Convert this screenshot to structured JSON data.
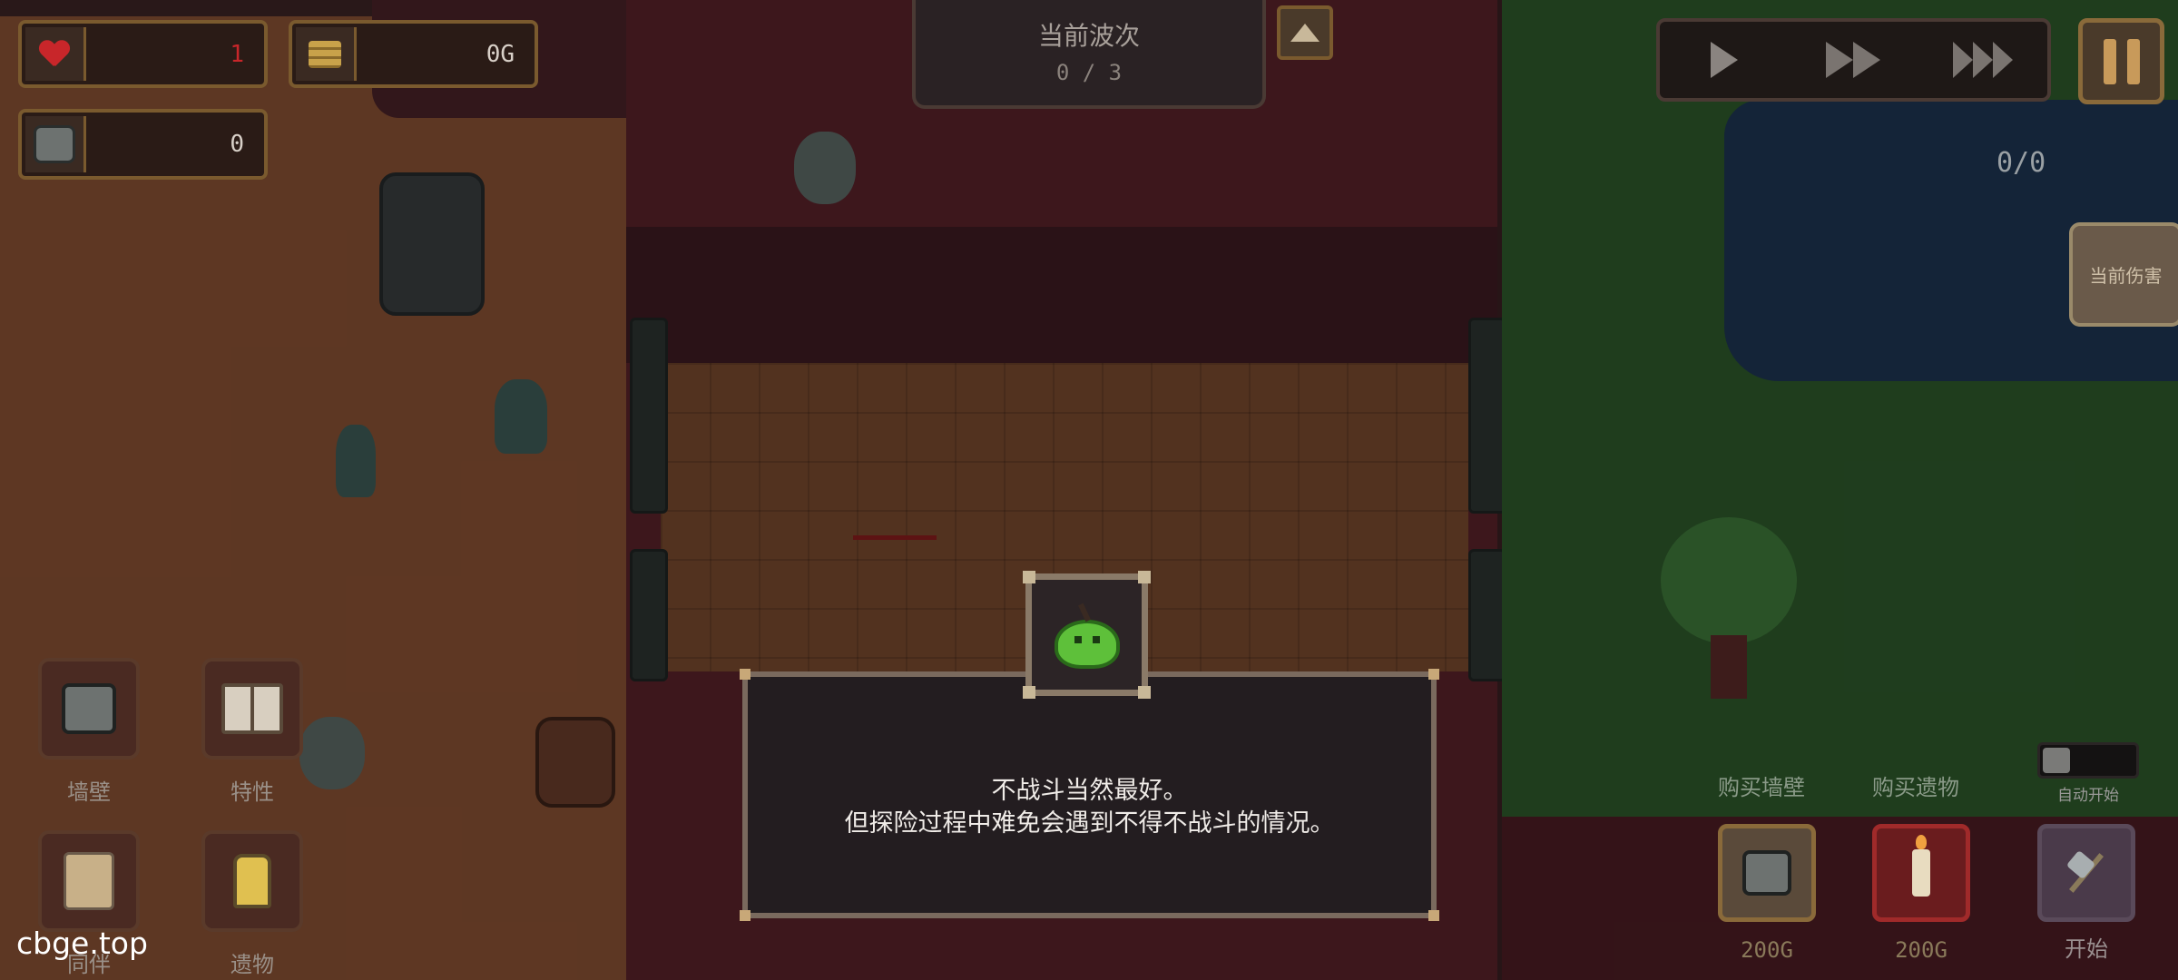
{
  "hud": {
    "health": "1",
    "gold": "0G",
    "stone": "0"
  },
  "wave": {
    "title": "当前波次",
    "count": "0 / 3"
  },
  "kills": "0/0",
  "damage_button": "当前伤害",
  "skills": [
    {
      "label": "墙壁",
      "icon": "stone-block-icon"
    },
    {
      "label": "特性",
      "icon": "book-icon"
    },
    {
      "label": "同伴",
      "icon": "scroll-icon"
    },
    {
      "label": "遗物",
      "icon": "lantern-icon"
    }
  ],
  "shop": {
    "buy_wall_label": "购买墙壁",
    "buy_relic_label": "购买遗物",
    "wall_price": "200G",
    "relic_price": "200G",
    "start_label": "开始",
    "auto_start_label": "自动开始"
  },
  "dialog": {
    "line1": "不战斗当然最好。",
    "line2": "但探险过程中难免会遇到不得不战斗的情况。"
  },
  "watermark": "cbge.top",
  "colors": {
    "health": "#c8262a",
    "panel_border": "#7a5a2e",
    "slime": "#5ec03a"
  }
}
